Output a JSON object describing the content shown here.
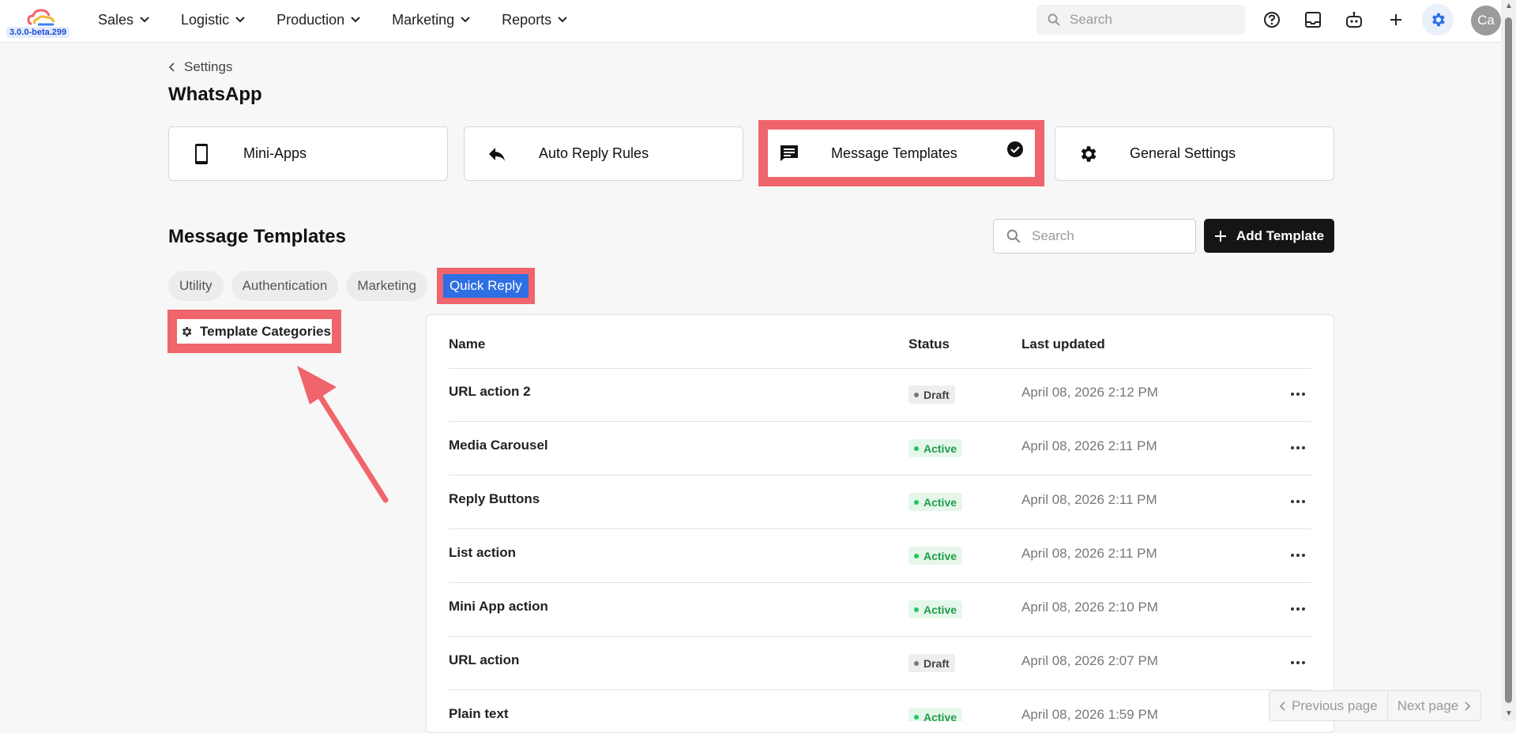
{
  "app": {
    "version": "3.0.0-beta.299"
  },
  "nav": {
    "items": [
      "Sales",
      "Logistic",
      "Production",
      "Marketing",
      "Reports"
    ]
  },
  "top_search": {
    "placeholder": "Search"
  },
  "user": {
    "initials": "Ca"
  },
  "breadcrumb": {
    "label": "Settings"
  },
  "page": {
    "title": "WhatsApp"
  },
  "cards": [
    {
      "label": "Mini-Apps",
      "icon": "smartphone-icon"
    },
    {
      "label": "Auto Reply Rules",
      "icon": "reply-icon"
    },
    {
      "label": "Message Templates",
      "icon": "message-icon",
      "selected": true
    },
    {
      "label": "General Settings",
      "icon": "gear-icon"
    }
  ],
  "section": {
    "title": "Message Templates",
    "search_placeholder": "Search",
    "add_label": "Add Template",
    "tabs": [
      "Utility",
      "Authentication",
      "Marketing",
      "Quick Reply"
    ],
    "active_tab": "Quick Reply",
    "categories_label": "Template Categories"
  },
  "table": {
    "headers": {
      "name": "Name",
      "status": "Status",
      "updated": "Last updated"
    },
    "rows": [
      {
        "name": "URL action 2",
        "status": "Draft",
        "updated": "April 08, 2026 2:12 PM"
      },
      {
        "name": "Media Carousel",
        "status": "Active",
        "updated": "April 08, 2026 2:11 PM"
      },
      {
        "name": "Reply Buttons",
        "status": "Active",
        "updated": "April 08, 2026 2:11 PM"
      },
      {
        "name": "List action",
        "status": "Active",
        "updated": "April 08, 2026 2:11 PM"
      },
      {
        "name": "Mini App action",
        "status": "Active",
        "updated": "April 08, 2026 2:10 PM"
      },
      {
        "name": "URL action",
        "status": "Draft",
        "updated": "April 08, 2026 2:07 PM"
      },
      {
        "name": "Plain text",
        "status": "Active",
        "updated": "April 08, 2026 1:59 PM"
      }
    ]
  },
  "pager": {
    "prev": "Previous page",
    "next": "Next page"
  },
  "colors": {
    "highlight": "#f0646c",
    "accent": "#2f6fe4",
    "active": "#22c55e"
  }
}
